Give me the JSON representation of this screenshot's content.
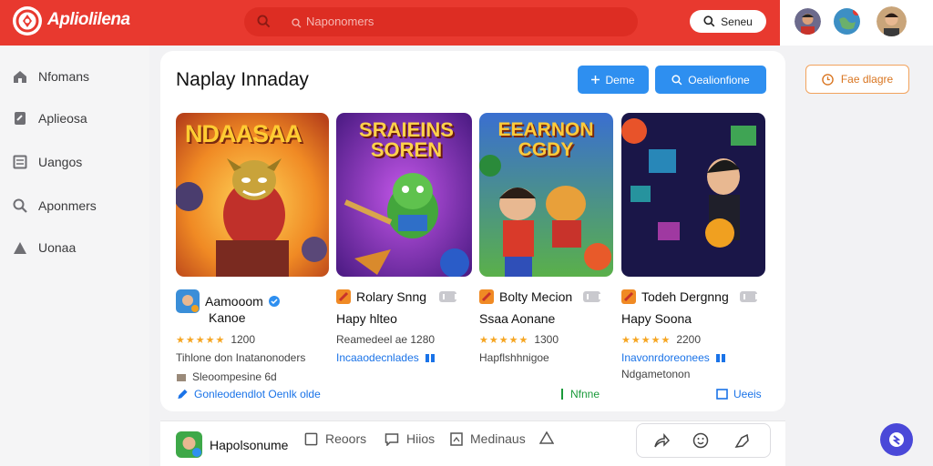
{
  "app": {
    "title": "Apliolilena"
  },
  "search": {
    "placeholder": "Naponomers",
    "button_label": "Seneu"
  },
  "sidebar": {
    "items": [
      {
        "label": "Nfomans",
        "icon": "home-icon"
      },
      {
        "label": "Aplieosa",
        "icon": "wrench-icon"
      },
      {
        "label": "Uangos",
        "icon": "list-icon"
      },
      {
        "label": "Aponmers",
        "icon": "search-icon"
      },
      {
        "label": "Uonaa",
        "icon": "warning-icon"
      }
    ]
  },
  "main": {
    "title": "Naplay Innaday",
    "btn_primary": "Deme",
    "btn_secondary": "Oealionfione",
    "btn_outline": "Fae dlagre"
  },
  "cards": [
    {
      "img_title": "NDAASAA",
      "name_line1": "Aamooom",
      "name_line2": "Kanoe",
      "rating": "1200",
      "line_a": "Tihlone don Inatanonoders",
      "line_b": "Sleoompesine 6d",
      "line_c": "Gonleodendlot Oenlk olde"
    },
    {
      "img_title": "SRAIEINS SOREN",
      "name_line1": "Rolary Snng",
      "name_line2": "Hapy hlteo",
      "rating": "",
      "line_a": "Reamedeel ae 1280",
      "line_b": "Incaaodecnlades",
      "line_c": ""
    },
    {
      "img_title": "EEARNON CGDY",
      "name_line1": "Bolty Mecion",
      "name_line2": "Ssaa Aonane",
      "rating": "1300",
      "line_a": "Hapflshhnigoe",
      "line_b": "",
      "line_c": "Nfnne"
    },
    {
      "img_title": "",
      "name_line1": "Todeh Dergnng",
      "name_line2": "Hapy Soona",
      "rating": "2200",
      "line_a": "Inavonrdoreonees",
      "line_b": "Ndgametonon",
      "line_c": "Ueeis"
    }
  ],
  "bottom": {
    "user_label": "Hapolsonume",
    "item1": "Reoors",
    "item2": "Hiios",
    "item3": "Medinaus"
  },
  "colors": {
    "brand_red": "#e8392f",
    "accent_blue": "#2e8ff0",
    "accent_orange": "#f2a35d",
    "fab_purple": "#4a48d8"
  }
}
